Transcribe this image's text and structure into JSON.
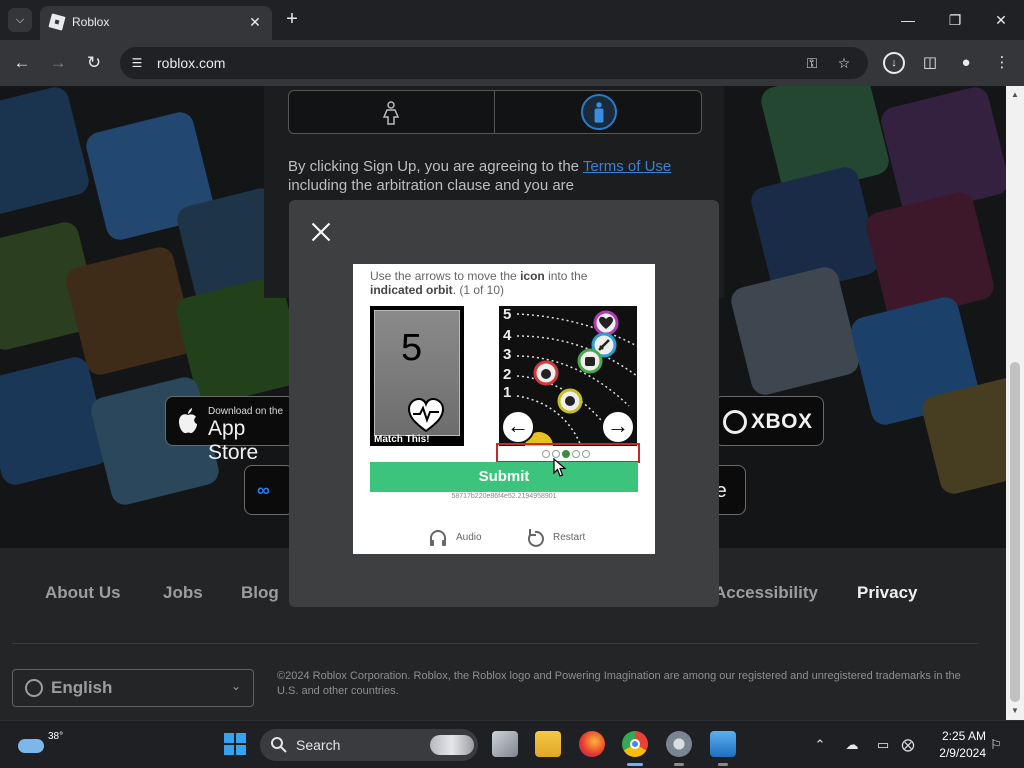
{
  "browser": {
    "tab_title": "Roblox",
    "url": "roblox.com",
    "colors": {
      "chrome_dark": "#202124",
      "toolbar": "#35363a"
    }
  },
  "signup": {
    "terms_prefix": "By clicking Sign Up, you are agreeing to the ",
    "terms_link": "Terms of Use",
    "terms_suffix": " including the arbitration clause and you are"
  },
  "badges": {
    "apple_small": "Download on the",
    "apple_big": "App Store",
    "xbox": "XBOX",
    "store2": "re"
  },
  "footer": {
    "links": [
      "About Us",
      "Jobs",
      "Blog",
      "Accessibility",
      "Privacy"
    ],
    "language": "English",
    "copyright": "©2024 Roblox Corporation. Roblox, the Roblox logo and Powering Imagination are among our registered and unregistered trademarks in the U.S. and other countries."
  },
  "captcha": {
    "instr_1": "Use the arrows to move the ",
    "instr_bold_1": "icon",
    "instr_2": " into the ",
    "instr_bold_2": "indicated orbit",
    "instr_3": ". (1 of 10)",
    "target_number": "5",
    "match_label": "Match This!",
    "orbit_numbers": [
      "5",
      "4",
      "3",
      "2",
      "1"
    ],
    "left_arrow": "←",
    "right_arrow": "→",
    "page_count": 5,
    "page_selected": 3,
    "submit_label": "Submit",
    "session_id": "58717b220e86f4e52.2194958901",
    "audio_label": "Audio",
    "restart_label": "Restart",
    "colors": {
      "submit": "#3cc47c",
      "highlight": "#c62828"
    }
  },
  "taskbar": {
    "temperature": "38°",
    "search_label": "Search",
    "time": "2:25 AM",
    "date": "2/9/2024"
  }
}
